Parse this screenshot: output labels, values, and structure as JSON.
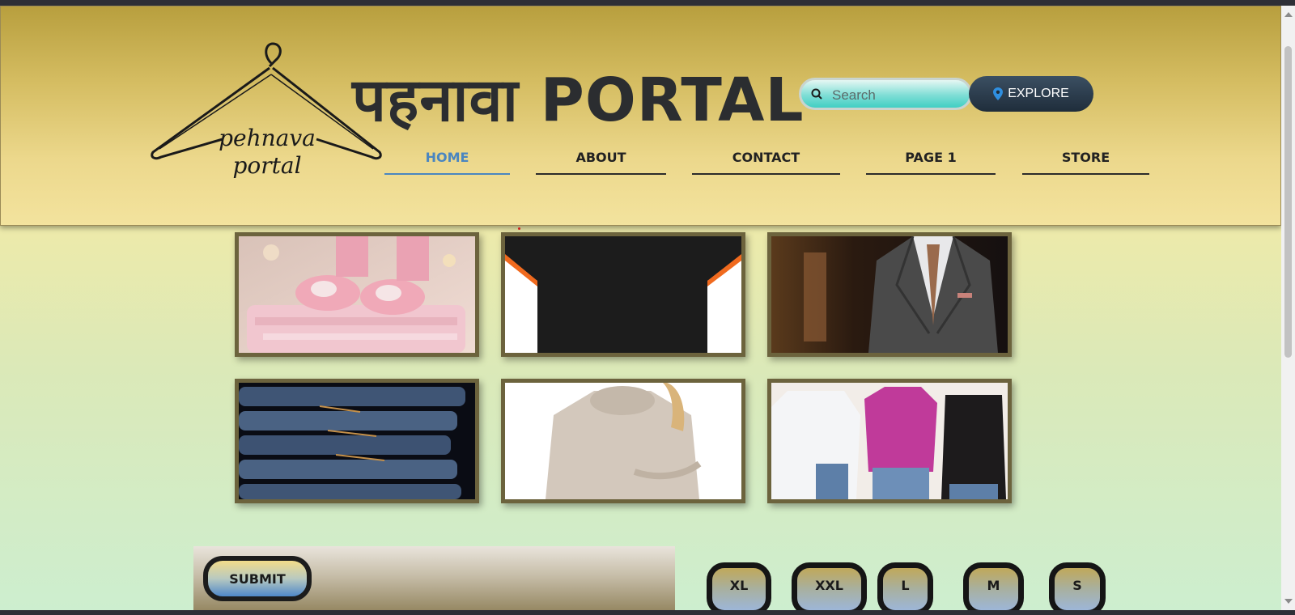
{
  "header": {
    "brand_title": "पहनावा PORTAL",
    "logo_text_line1": "pehnava",
    "logo_text_line2": "portal",
    "search": {
      "placeholder": "Search"
    },
    "explore_label": "EXPLORE"
  },
  "nav": {
    "items": [
      {
        "label": "HOME",
        "active": true
      },
      {
        "label": "ABOUT",
        "active": false
      },
      {
        "label": "CONTACT",
        "active": false
      },
      {
        "label": "PAGE 1",
        "active": false
      },
      {
        "label": "STORE",
        "active": false
      }
    ]
  },
  "gallery": {
    "images": [
      {
        "name": "baby-booties-image"
      },
      {
        "name": "black-tshirt-image"
      },
      {
        "name": "suit-jacket-image"
      },
      {
        "name": "jeans-stack-image"
      },
      {
        "name": "sweater-woman-image"
      },
      {
        "name": "women-tops-image"
      }
    ]
  },
  "form": {
    "submit_label": "SUBMIT"
  },
  "sizes": [
    "XL",
    "XXL",
    "L",
    "M",
    "S"
  ],
  "colors": {
    "header_top": "#b89f3e",
    "header_bottom": "#f3e39e",
    "active_nav": "#4a86c0",
    "explore_bg": "#2a3b4c",
    "tile_border": "#6c633d"
  }
}
